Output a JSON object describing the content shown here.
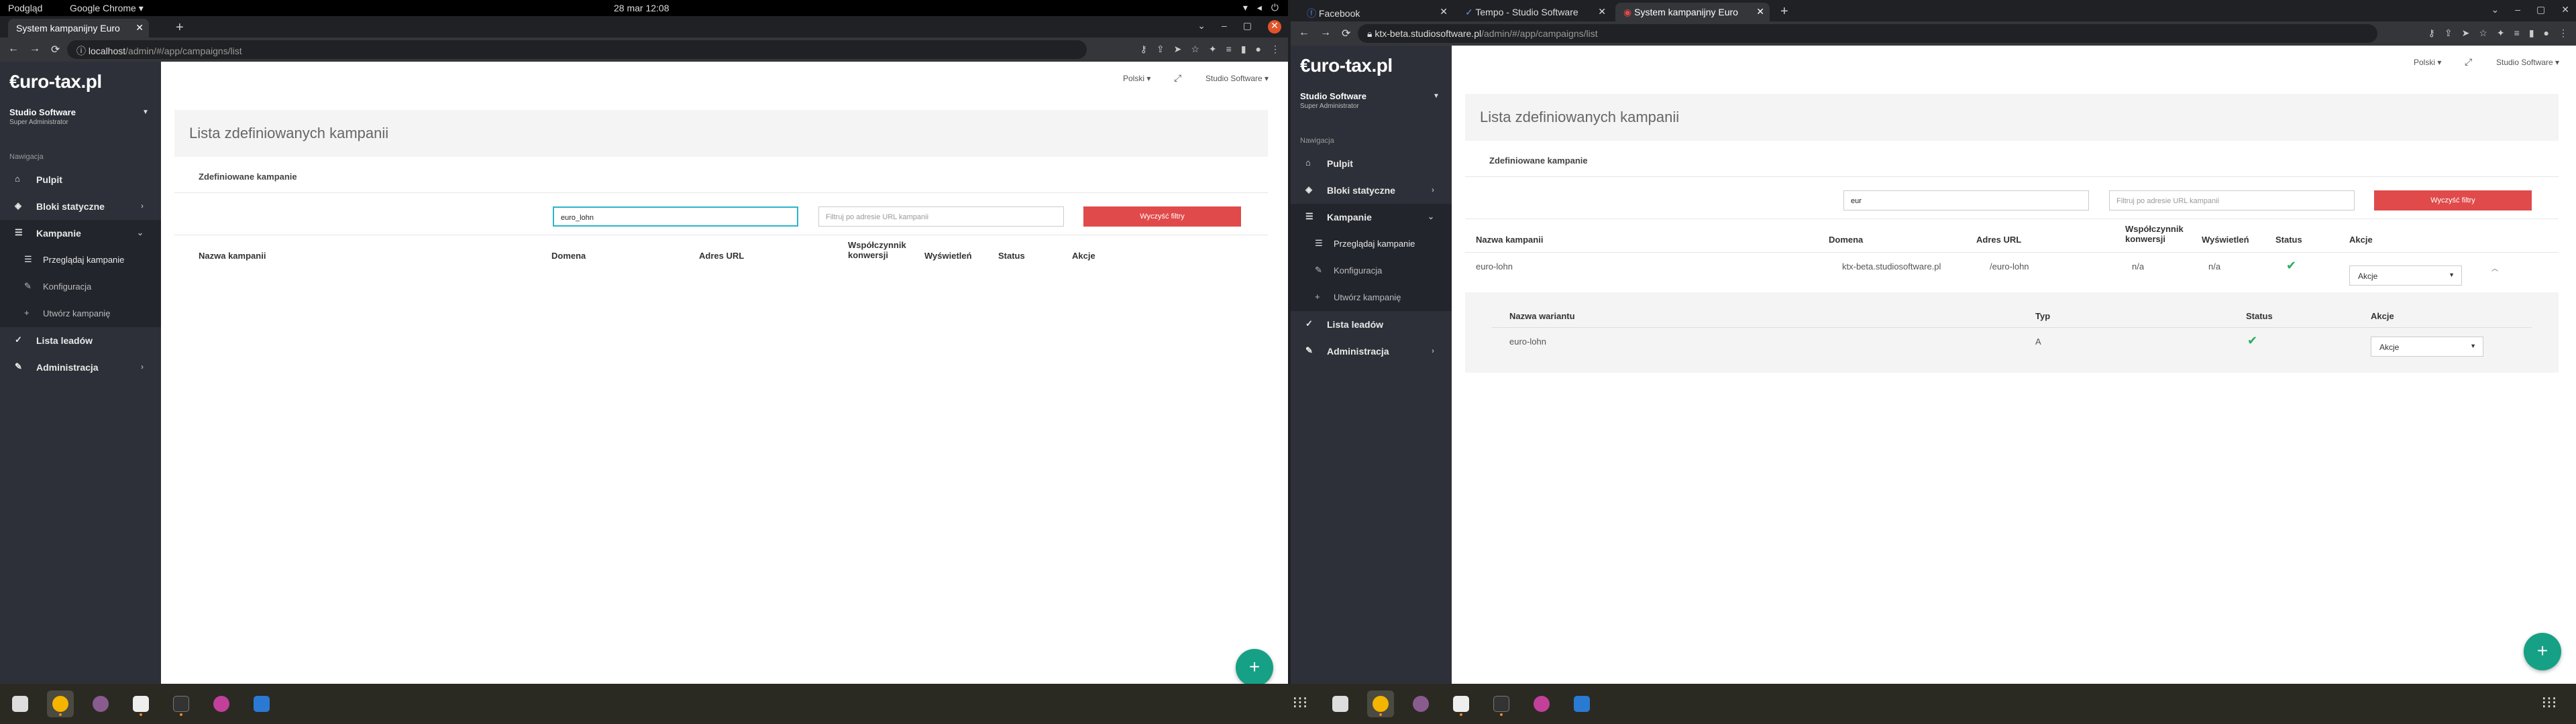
{
  "os_topbar": {
    "left_label": "Podgląd",
    "app_label": "Google Chrome ▾",
    "datetime": "28 mar  12:08"
  },
  "left_window": {
    "tab_title": "System kampanijny Euro",
    "url_host": "localhost",
    "url_path": "/admin/#/app/campaigns/list",
    "app": {
      "logo": "€uro-tax.pl",
      "org_name": "Studio Software",
      "org_role": "Super Administrator",
      "nav_header": "Nawigacja",
      "menu": [
        "Pulpit",
        "Bloki statyczne",
        "Kampanie",
        "Przeglądaj kampanie",
        "Konfiguracja",
        "Utwórz kampanię",
        "Lista leadów",
        "Administracja"
      ],
      "language": "Polski ▾",
      "user": "Studio Software ▾",
      "page_title": "Lista zdefiniowanych kampanii",
      "card_title": "Zdefiniowane kampanie",
      "filter_name_value": "euro_lohn",
      "filter_url_placeholder": "Filtruj po adresie URL kampanii",
      "clear_filters": "Wyczyść filtry",
      "columns": [
        "Nazwa kampanii",
        "Domena",
        "Adres URL",
        "Współczynnik konwersji",
        "Wyświetleń",
        "Status",
        "Akcje"
      ]
    }
  },
  "right_window": {
    "tabs": [
      "Facebook",
      "Tempo - Studio Software",
      "System kampanijny Euro"
    ],
    "url_host": "ktx-beta.studiosoftware.pl",
    "url_path": "/admin/#/app/campaigns/list",
    "app": {
      "logo": "€uro-tax.pl",
      "org_name": "Studio Software",
      "org_role": "Super Administrator",
      "nav_header": "Nawigacja",
      "menu": [
        "Pulpit",
        "Bloki statyczne",
        "Kampanie",
        "Przeglądaj kampanie",
        "Konfiguracja",
        "Utwórz kampanię",
        "Lista leadów",
        "Administracja"
      ],
      "language": "Polski ▾",
      "user": "Studio Software ▾",
      "page_title": "Lista zdefiniowanych kampanii",
      "card_title": "Zdefiniowane kampanie",
      "filter_name_value": "eur",
      "filter_url_placeholder": "Filtruj po adresie URL kampanii",
      "clear_filters": "Wyczyść filtry",
      "columns": [
        "Nazwa kampanii",
        "Domena",
        "Adres URL",
        "Współczynnik konwersji",
        "Wyświetleń",
        "Status",
        "Akcje"
      ],
      "row": {
        "name": "euro-lohn",
        "domain": "ktx-beta.studiosoftware.pl",
        "url": "/euro-lohn",
        "conversion": "n/a",
        "views": "n/a",
        "actions": "Akcje"
      },
      "variant_columns": [
        "Nazwa wariantu",
        "Typ",
        "Status",
        "Akcje"
      ],
      "variant_row": {
        "name": "euro-lohn",
        "type": "A",
        "actions": "Akcje"
      }
    }
  },
  "fab_label": "+",
  "colors": {
    "sidebar": "#2d3038",
    "accent_red": "#e04a4a",
    "fab": "#16a085",
    "check": "#27ae60"
  }
}
